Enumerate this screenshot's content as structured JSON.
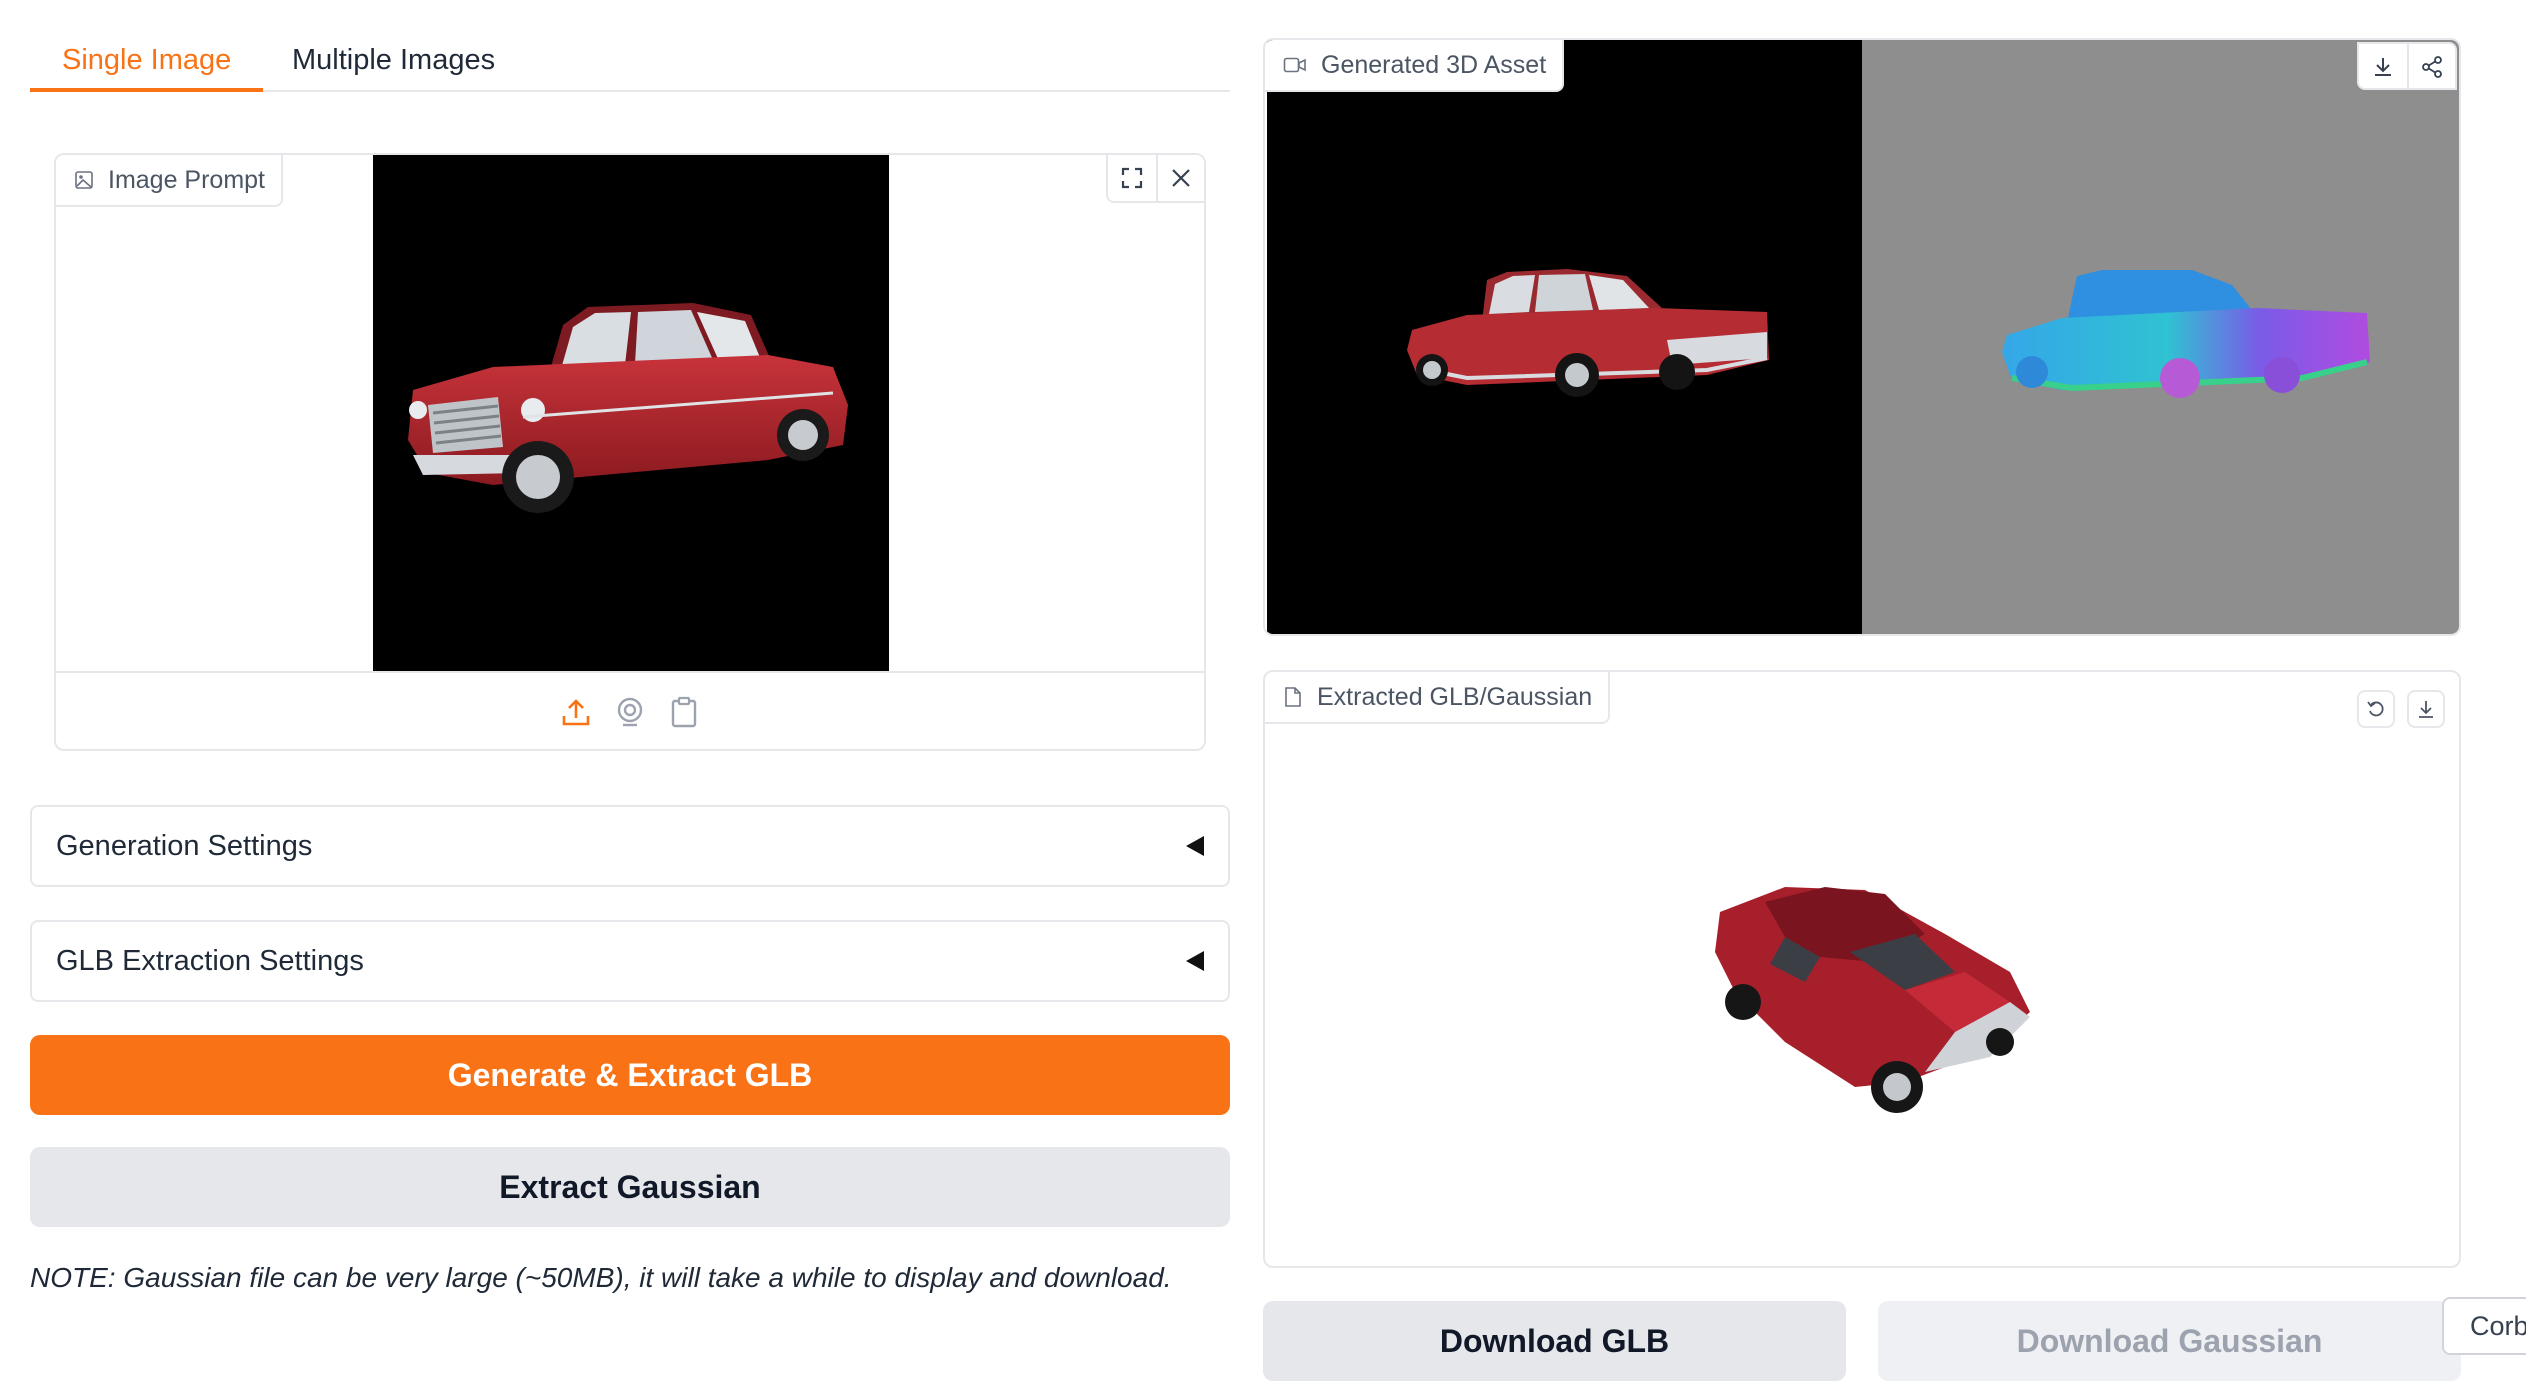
{
  "tabs": [
    {
      "label": "Single Image",
      "active": true
    },
    {
      "label": "Multiple Images",
      "active": false
    }
  ],
  "image_prompt": {
    "label": "Image Prompt",
    "icon": "image-icon",
    "tools": [
      "fullscreen-icon",
      "close-icon"
    ],
    "sources": [
      "upload-icon",
      "webcam-icon",
      "clipboard-icon"
    ]
  },
  "accordions": {
    "generation": "Generation Settings",
    "glb_extraction": "GLB Extraction Settings"
  },
  "buttons": {
    "generate": "Generate & Extract GLB",
    "extract_gaussian": "Extract Gaussian",
    "download_glb": "Download GLB",
    "download_gaussian": "Download Gaussian"
  },
  "note": "NOTE: Gaussian file can be very large (~50MB), it will take a while to display and download.",
  "generated_asset": {
    "label": "Generated 3D Asset",
    "icon": "video-icon",
    "tools": [
      "download-icon",
      "share-icon"
    ]
  },
  "extracted": {
    "label": "Extracted GLB/Gaussian",
    "icon": "file-icon",
    "tools": [
      "undo-icon",
      "download-icon"
    ]
  },
  "tooltip": "Corb",
  "colors": {
    "accent": "#f97316",
    "secondary_button": "#e5e7eb",
    "border": "#e5e7eb",
    "render_bg_gray": "#8e8e8e"
  }
}
